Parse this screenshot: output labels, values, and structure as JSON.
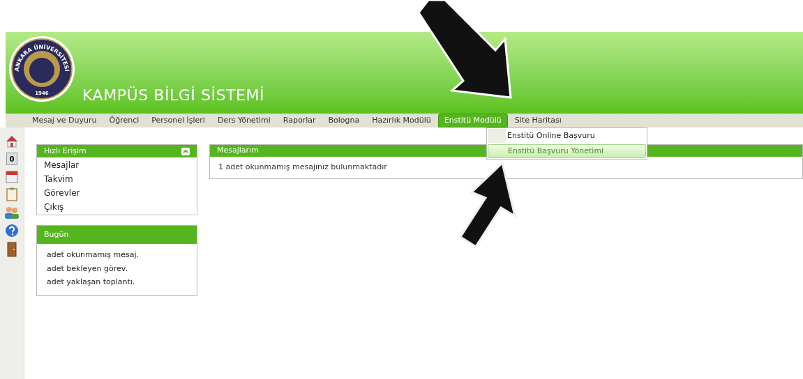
{
  "header": {
    "logo_ring": "ANKARA ÜNİVERSİTESİ",
    "logo_year": "1946",
    "title": "KAMPÜS BİLGİ SİSTEMİ"
  },
  "menu": [
    {
      "label": "Mesaj ve Duyuru",
      "selected": false
    },
    {
      "label": "Öğrenci",
      "selected": false
    },
    {
      "label": "Personel İşleri",
      "selected": false
    },
    {
      "label": "Ders Yönetimi",
      "selected": false
    },
    {
      "label": "Raporlar",
      "selected": false
    },
    {
      "label": "Bologna",
      "selected": false
    },
    {
      "label": "Hazırlık Modülü",
      "selected": false
    },
    {
      "label": "Enstitü Modülü",
      "selected": true
    },
    {
      "label": "Site Haritası",
      "selected": false
    }
  ],
  "dropdown": [
    {
      "label": "Enstitü Online Başvuru",
      "selected": false
    },
    {
      "label": "Enstitü Başvuru Yönetimi",
      "selected": true
    }
  ],
  "icon_strip": [
    {
      "kind": "home"
    },
    {
      "kind": "counter",
      "text": "0"
    },
    {
      "kind": "calendar"
    },
    {
      "kind": "clipboard"
    },
    {
      "kind": "users"
    },
    {
      "kind": "help"
    },
    {
      "kind": "door"
    }
  ],
  "quick_access": {
    "title": "Hızlı Erişim",
    "expanded": true,
    "items": [
      "Mesajlar",
      "Takvim",
      "Görevler",
      "Çıkış"
    ]
  },
  "today": {
    "title": "Bugün",
    "items": [
      "adet okunmamış mesaj.",
      "adet bekleyen görev.",
      "adet yaklaşan toplantı."
    ]
  },
  "messages": {
    "title": "Mesajlarım",
    "text": "1 adet okunmamış mesajınız bulunmaktadır"
  }
}
